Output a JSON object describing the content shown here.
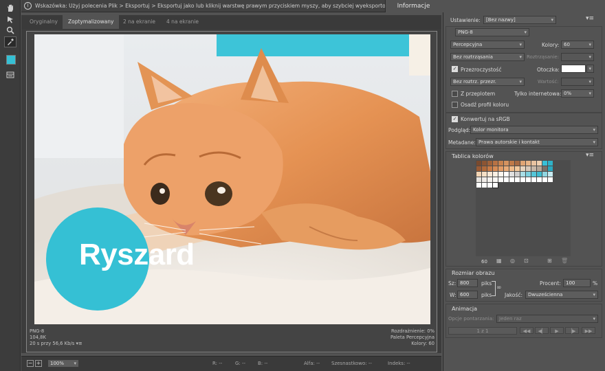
{
  "toolbar": {
    "tools": [
      "hand-tool-icon",
      "slice-select-tool-icon",
      "zoom-tool-icon",
      "eyedropper-tool-icon",
      "eyedropper-color-swatch",
      "toggle-slices-icon"
    ],
    "eyedropper_color": "#35c0d4"
  },
  "topbar": {
    "hint": "Wskazówka: Użyj polecenia Plik > Eksportuj > Eksportuj jako lub kliknij warstwę prawym przyciskiem myszy, aby szybciej wyeksportować zasoby.",
    "info_tab": "Informacje"
  },
  "tabs": [
    {
      "label": "Oryginalny"
    },
    {
      "label": "Zoptymalizowany"
    },
    {
      "label": "2 na ekranie"
    },
    {
      "label": "4 na ekranie"
    }
  ],
  "preview": {
    "overlay_text": "Ryszard",
    "overlay_color": "#35c0d4",
    "left": [
      "PNG-8",
      "104,8K",
      "20 s przy 56,6 Kb/s"
    ],
    "right": [
      "Rozdrażnienie: 0%",
      "Paleta Percepcyjna",
      "Kolory: 60"
    ]
  },
  "statusbar": {
    "zoom": "100%",
    "r": "R: --",
    "g": "G: --",
    "b": "B: --",
    "alpha": "Alfa: --",
    "hex": "Szesnastkowo: --",
    "index": "Indeks: --"
  },
  "settings": {
    "preset_label": "Ustawienie:",
    "preset_value": "[Bez nazwy]",
    "format": "PNG-8",
    "reduction": "Percepcyjna",
    "colors_label": "Kolory:",
    "colors_value": "60",
    "dither_algo": "Bez roztrząsania",
    "dither_label": "Roztrząsanie:",
    "transparency_label": "Przezroczystość",
    "matte_label": "Otoczka:",
    "transparency_dither": "Bez roztrz. przezr.",
    "amount_label": "Wartość:",
    "interlaced_label": "Z przeplotem",
    "websnap_label": "Tylko internetowa:",
    "websnap_value": "0%",
    "embed_profile_label": "Osadź profil koloru",
    "convert_srgb_label": "Konwertuj na sRGB",
    "preview_label": "Podgląd:",
    "preview_value": "Kolor monitora",
    "metadata_label": "Metadane:",
    "metadata_value": "Prawa autorskie i kontakt"
  },
  "color_table": {
    "title": "Tablica kolorów",
    "count": "60",
    "colors": [
      "#7a4a2e",
      "#8c5533",
      "#a0623a",
      "#b87243",
      "#c9834f",
      "#d5935f",
      "#c07a48",
      "#a86a42",
      "#e0a574",
      "#e8b588",
      "#e8c3a0",
      "#f0d0b0",
      "#38bfd6",
      "#2fb2c8",
      "#9a5a34",
      "#b06a3b",
      "#c87a45",
      "#d88c55",
      "#e39c66",
      "#eaab77",
      "#f0bb8a",
      "#f3c89b",
      "#e7d3bd",
      "#d8c8b8",
      "#c8b8a8",
      "#b8a898",
      "#7a7068",
      "#2aa8be",
      "#f3d4b3",
      "#f6e0c6",
      "#f8e8d6",
      "#faf0e4",
      "#fcf6ef",
      "#ffffff",
      "#e0e0e0",
      "#cfcfcf",
      "#a8dde6",
      "#7cd0de",
      "#55c6d8",
      "#3fbcd0",
      "#90d6e2",
      "#c6eaf0",
      "#e8e4df",
      "#f0ece8",
      "#f5f2ee",
      "#faf8f5",
      "#fdfcfa",
      "#ffffff",
      "#ffffff",
      "#ffffff",
      "#ffffff",
      "#ffffff",
      "#ffffff",
      "#ffffff",
      "#ffffff",
      "#ffffff",
      "#ffffff",
      "#ffffff",
      "#ffffff",
      "#ffffff"
    ]
  },
  "image_size": {
    "title": "Rozmiar obrazu",
    "w_label": "Sz:",
    "w_value": "800",
    "h_label": "W:",
    "h_value": "600",
    "unit": "piks",
    "percent_label": "Procent:",
    "percent_value": "100",
    "percent_sign": "%",
    "quality_label": "Jakość:",
    "quality_value": "Dwuześcienna"
  },
  "animation": {
    "title": "Animacja",
    "loop_label": "Opcje pontarzania:",
    "loop_value": "Jeden raz",
    "frame_counter": "1 z 1"
  }
}
